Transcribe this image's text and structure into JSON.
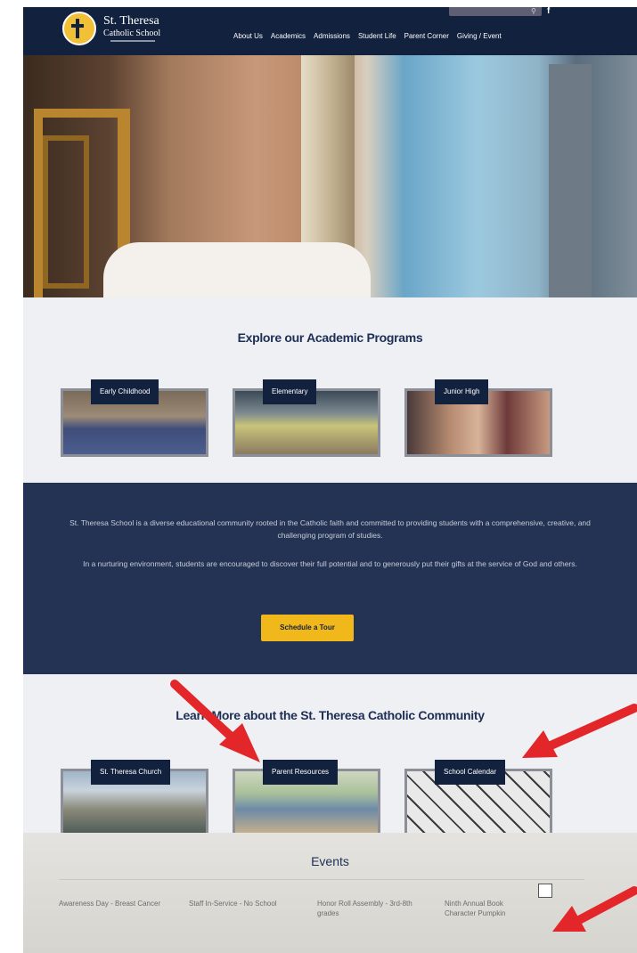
{
  "header": {
    "brand_line1": "St. Theresa",
    "brand_line2": "Catholic School",
    "nav": [
      "About Us",
      "Academics",
      "Admissions",
      "Student Life",
      "Parent Corner",
      "Giving / Event"
    ]
  },
  "academic": {
    "title": "Explore our Academic Programs",
    "cards": [
      "Early Childhood",
      "Elementary",
      "Junior High"
    ]
  },
  "mission": {
    "paragraph1": "St. Theresa School is a diverse educational community rooted in the Catholic faith and committed to providing students with a comprehensive, creative, and challenging program of studies.",
    "paragraph2": "In a nurturing environment, students are encouraged to discover their full potential and to generously put their gifts at the service of God and others.",
    "button": "Schedule a Tour"
  },
  "community": {
    "title": "Learn More about the St. Theresa Catholic Community",
    "cards": [
      "St. Theresa Church",
      "Parent Resources",
      "School Calendar"
    ]
  },
  "events": {
    "title": "Events",
    "items": [
      "Awareness Day - Breast Cancer",
      "Staff In-Service - No School",
      "Honor Roll Assembly - 3rd-8th grades",
      "Ninth Annual Book Character Pumpkin"
    ]
  },
  "colors": {
    "navy": "#12213d",
    "gold": "#f0b81b",
    "arrow": "#e3262a"
  }
}
